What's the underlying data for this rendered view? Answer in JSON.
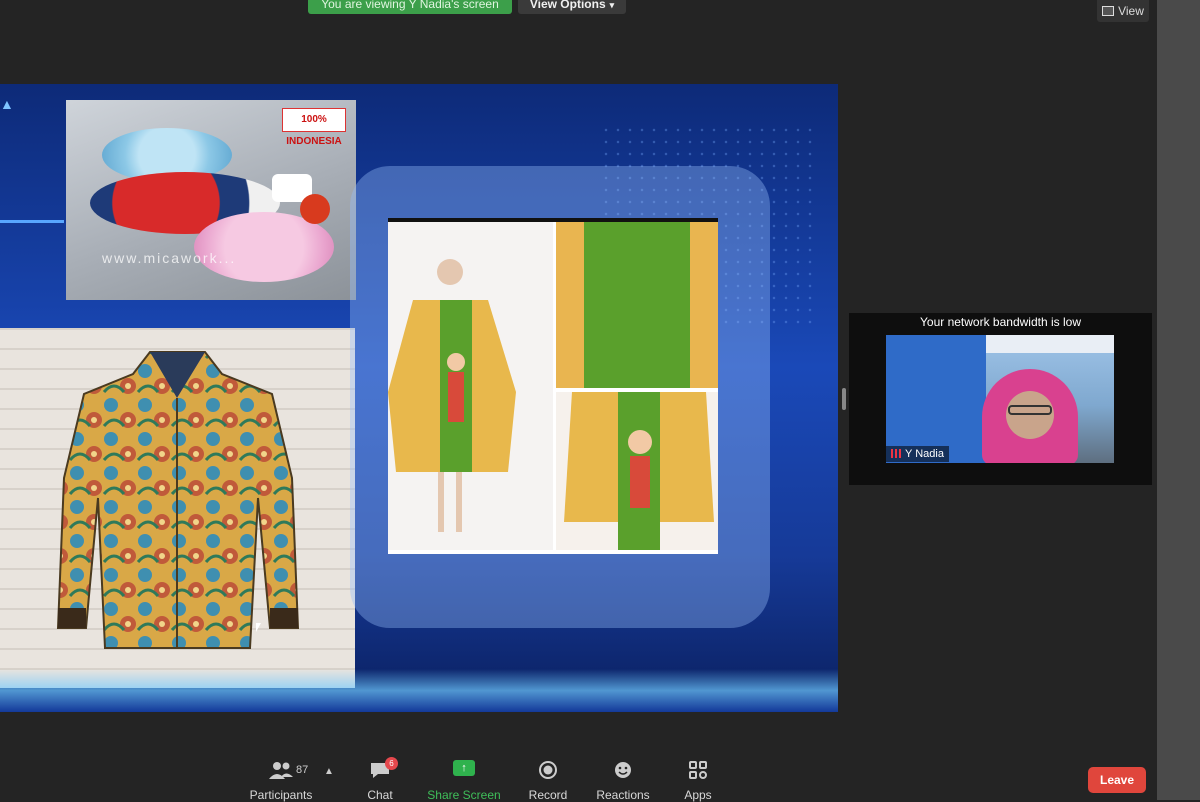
{
  "topbar": {
    "viewing_banner": "You are viewing Y Nadia's screen",
    "view_options": "View Options",
    "view_button": "View"
  },
  "shared_screen": {
    "badge_text": "100% INDONESIA",
    "watermark_text": "www.micawork..."
  },
  "video_tile": {
    "bandwidth_notice": "Your network bandwidth is low",
    "participant_name": "Y Nadia"
  },
  "toolbar": {
    "participants_count": "87",
    "chat_badge": "6",
    "items": [
      {
        "label": "Participants",
        "icon": "people-icon"
      },
      {
        "label": "Chat",
        "icon": "chat-icon"
      },
      {
        "label": "Share Screen",
        "icon": "share-screen-icon"
      },
      {
        "label": "Record",
        "icon": "record-icon"
      },
      {
        "label": "Reactions",
        "icon": "reactions-icon"
      },
      {
        "label": "Apps",
        "icon": "apps-icon"
      }
    ],
    "leave_label": "Leave"
  },
  "colors": {
    "accent_green": "#3c9f4a",
    "leave_red": "#e0463c",
    "slide_blue": "#1a49b8"
  }
}
